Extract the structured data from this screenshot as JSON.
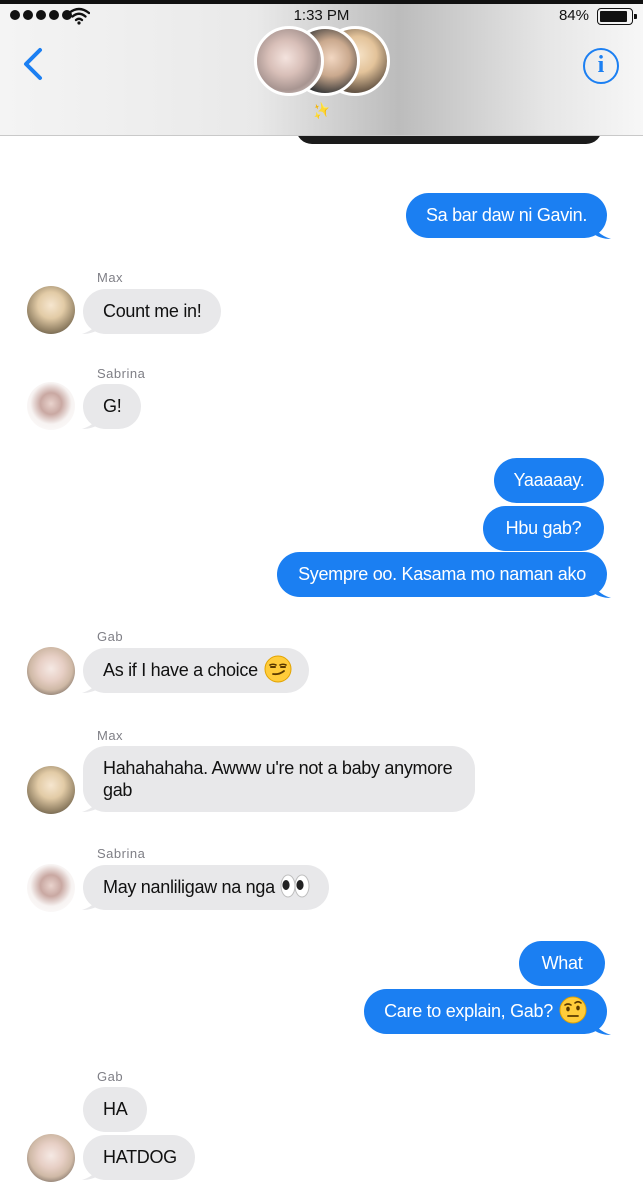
{
  "status_bar": {
    "time": "1:33 PM",
    "battery": "84%"
  },
  "header": {
    "sparkle_icon": "✨"
  },
  "colors": {
    "accent": "#1b7ff2",
    "incoming_bubble": "#e8e8ea",
    "outgoing_text": "#ffffff"
  },
  "messages": {
    "m1": {
      "text": "Sa bar daw ni Gavin."
    },
    "m2": {
      "sender": "Max",
      "text": "Count me in!"
    },
    "m3": {
      "sender": "Sabrina",
      "text": "G!"
    },
    "m4": {
      "text": "Yaaaaay."
    },
    "m5": {
      "text": "Hbu gab?"
    },
    "m6": {
      "text": "Syempre oo. Kasama mo naman ako"
    },
    "m7": {
      "sender": "Gab",
      "text": "As if I have a choice"
    },
    "m8": {
      "sender": "Max",
      "text": "Hahahahaha. Awww u're not a baby anymore gab"
    },
    "m9": {
      "sender": "Sabrina",
      "text": "May nanliligaw na nga"
    },
    "m10": {
      "text": "What"
    },
    "m11": {
      "text": "Care to explain, Gab?"
    },
    "m12": {
      "sender": "Gab",
      "text": "HA"
    },
    "m13": {
      "text": "HATDOG"
    }
  }
}
